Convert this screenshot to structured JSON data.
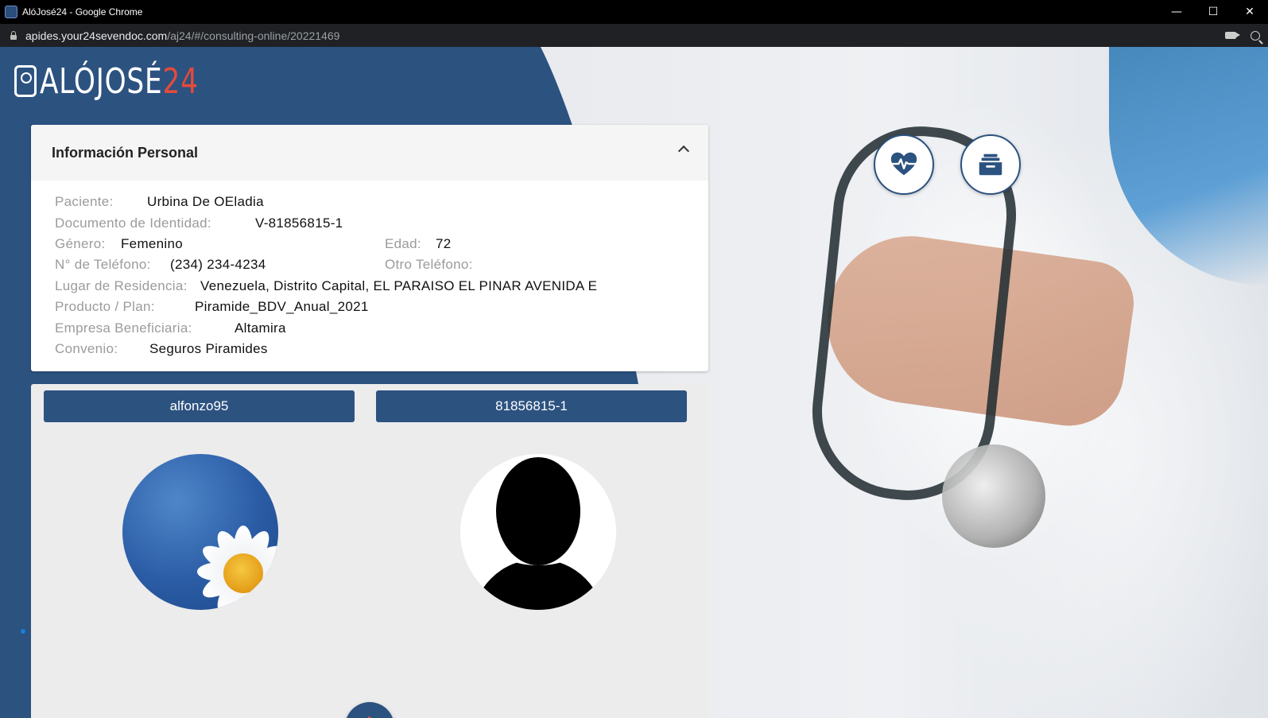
{
  "window": {
    "title": "AlóJosé24 - Google Chrome",
    "controls": {
      "minimize": "—",
      "maximize": "☐",
      "close": "✕"
    }
  },
  "address_bar": {
    "host": "apides.your24sevendoc.com",
    "path": "/aj24/#/consulting-online/20221469"
  },
  "logo": {
    "text": "ALÓJOSÉ",
    "number": "24"
  },
  "personal_info": {
    "title": "Información Personal",
    "fields": {
      "paciente": {
        "label": "Paciente:",
        "value": "Urbina De OEladia"
      },
      "documento": {
        "label": "Documento de Identidad:",
        "value": "V-81856815-1"
      },
      "genero": {
        "label": "Género:",
        "value": "Femenino"
      },
      "edad": {
        "label": "Edad:",
        "value": "72"
      },
      "telefono": {
        "label": "N° de Teléfono:",
        "value": "(234) 234-4234"
      },
      "otro_telefono": {
        "label": "Otro Teléfono:",
        "value": ""
      },
      "residencia": {
        "label": "Lugar de Residencia:",
        "value": "Venezuela, Distrito Capital, EL PARAISO EL PINAR AVENIDA E"
      },
      "producto": {
        "label": "Producto / Plan:",
        "value": "Piramide_BDV_Anual_2021"
      },
      "empresa": {
        "label": "Empresa Beneficiaria:",
        "value": "Altamira"
      },
      "convenio": {
        "label": "Convenio:",
        "value": "Seguros Piramides"
      }
    }
  },
  "video_call": {
    "doctor_username": "alfonzo95",
    "patient_id": "81856815-1"
  },
  "colors": {
    "brand_blue": "#2c5280",
    "accent_red": "#e34b3c"
  },
  "icons": {
    "vitals": "heart-pulse-icon",
    "records": "archive-box-icon",
    "hangup": "power-icon"
  }
}
